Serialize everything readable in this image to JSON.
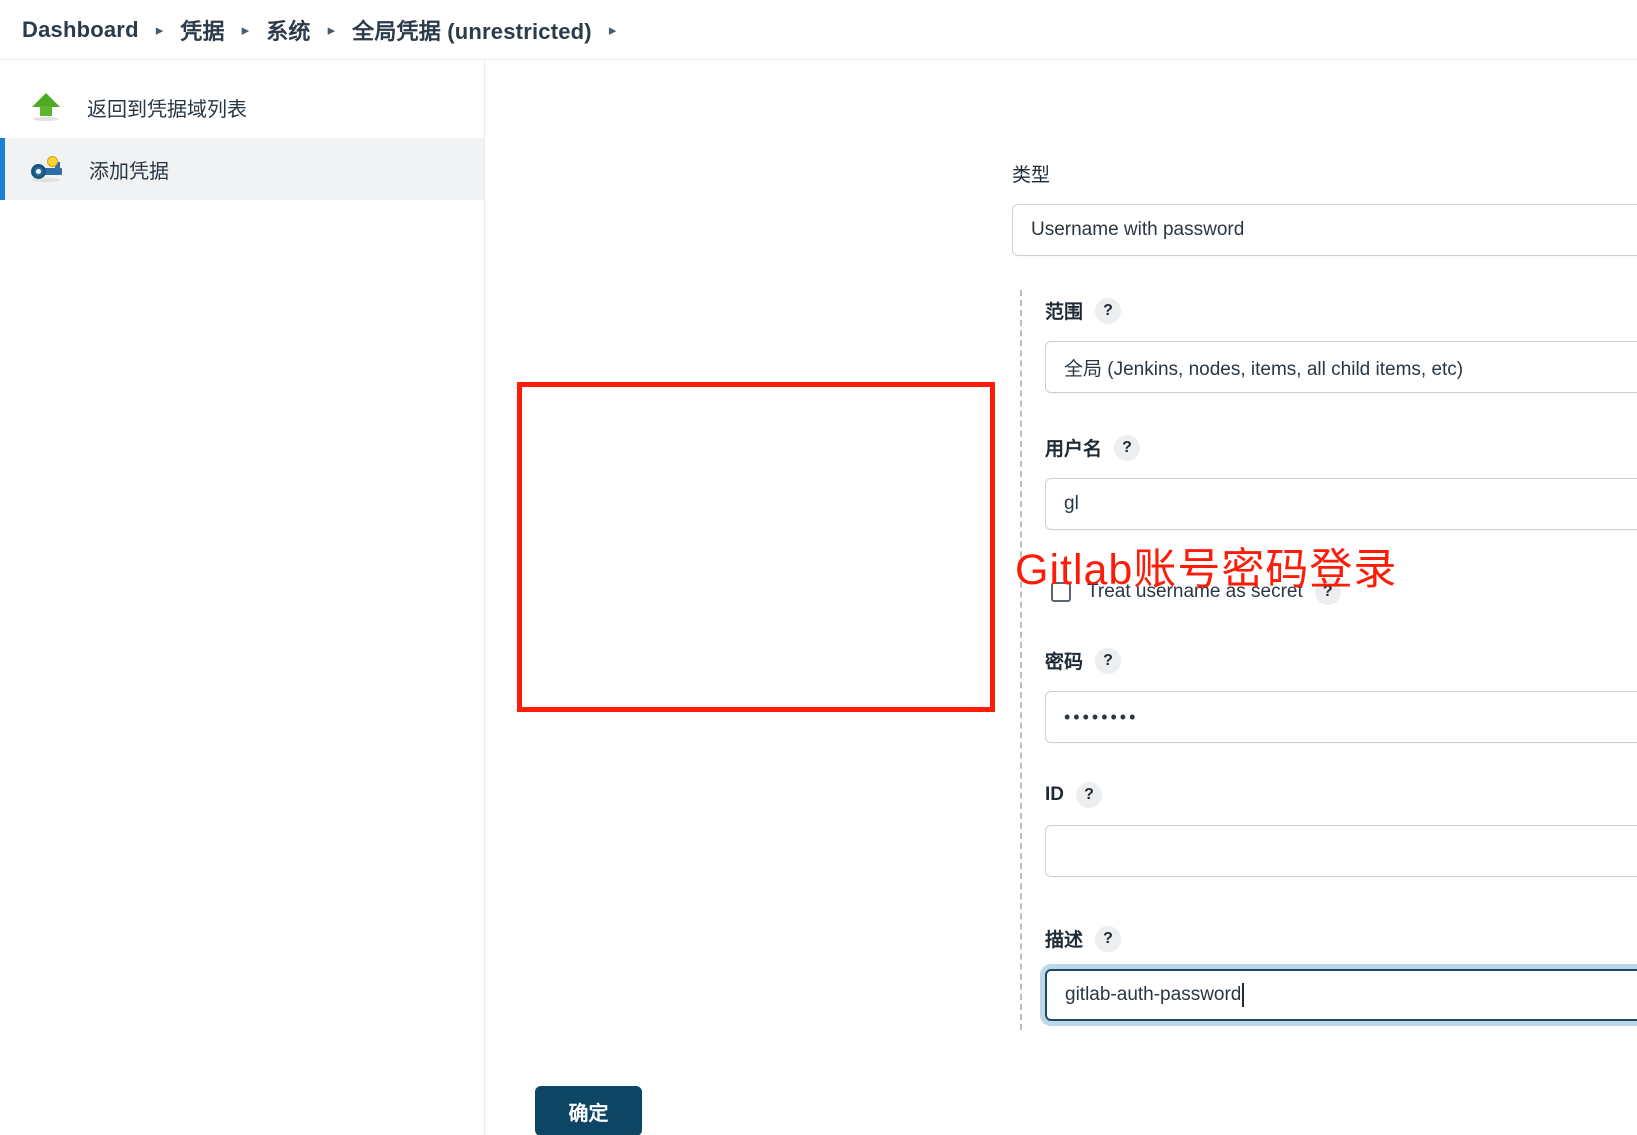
{
  "breadcrumb": {
    "items": [
      {
        "label": "Dashboard"
      },
      {
        "label": "凭据"
      },
      {
        "label": "系统"
      },
      {
        "label": "全局凭据 (unrestricted)"
      }
    ],
    "separator": "▸"
  },
  "sidebar": {
    "items": [
      {
        "label": "返回到凭据域列表",
        "icon": "up-arrow-icon",
        "active": false
      },
      {
        "label": "添加凭据",
        "icon": "key-icon",
        "active": true
      }
    ]
  },
  "form": {
    "type": {
      "label": "类型",
      "value": "Username with password"
    },
    "scope": {
      "label": "范围",
      "help": "?",
      "value": "全局 (Jenkins, nodes, items, all child items, etc)"
    },
    "username": {
      "label": "用户名",
      "help": "?",
      "value": "gl"
    },
    "treat_secret": {
      "label": "Treat username as secret",
      "help": "?",
      "checked": false
    },
    "password": {
      "label": "密码",
      "help": "?",
      "value": "••••••••"
    },
    "id": {
      "label": "ID",
      "help": "?",
      "value": ""
    },
    "description": {
      "label": "描述",
      "help": "?",
      "value": "gitlab-auth-password",
      "focused": true
    },
    "submit": {
      "label": "确定"
    }
  },
  "annotation": {
    "text": "Gitlab账号密码登录",
    "color": "#fc1c07"
  }
}
